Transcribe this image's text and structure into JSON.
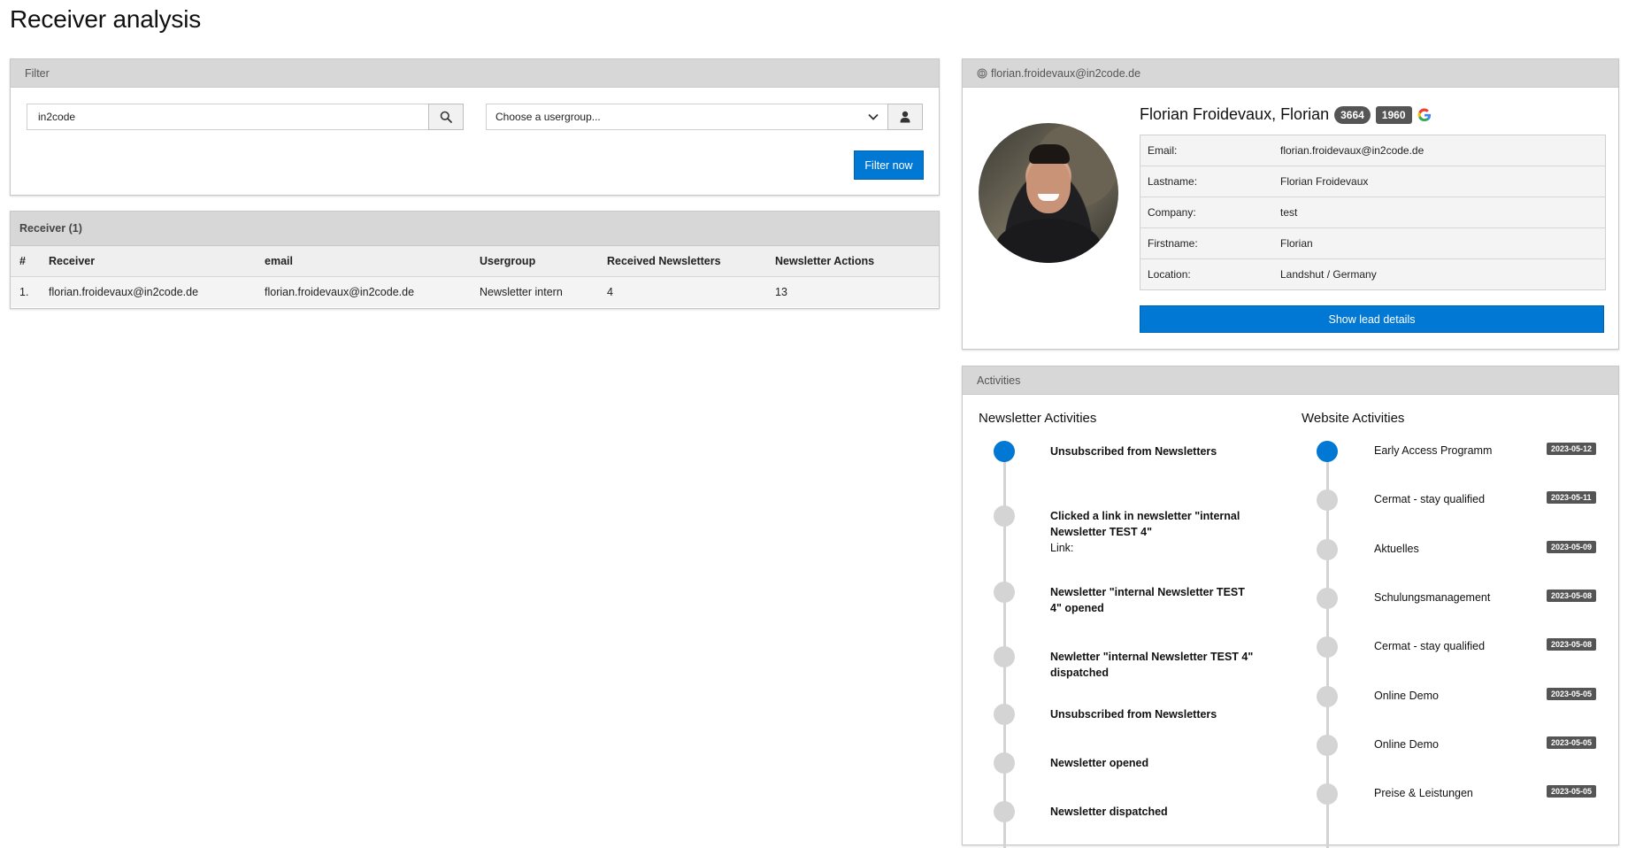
{
  "page": {
    "title": "Receiver analysis"
  },
  "filter": {
    "heading": "Filter",
    "search_value": "in2code",
    "usergroup_placeholder": "Choose a usergroup...",
    "submit_label": "Filter now"
  },
  "receiver": {
    "heading": "Receiver (1)",
    "columns": [
      "#",
      "Receiver",
      "email",
      "Usergroup",
      "Received Newsletters",
      "Newsletter Actions"
    ],
    "rows": [
      {
        "index": "1.",
        "receiver": "florian.froidevaux@in2code.de",
        "email": "florian.froidevaux@in2code.de",
        "usergroup": "Newsletter intern",
        "received": "4",
        "actions": "13"
      }
    ]
  },
  "lead": {
    "header_email": "florian.froidevaux@in2code.de",
    "name": "Florian Froidevaux, Florian",
    "badge_1": "3664",
    "badge_2": "1960",
    "details": [
      {
        "label": "Email:",
        "value": "florian.froidevaux@in2code.de"
      },
      {
        "label": "Lastname:",
        "value": "Florian Froidevaux"
      },
      {
        "label": "Company:",
        "value": "test"
      },
      {
        "label": "Firstname:",
        "value": "Florian"
      },
      {
        "label": "Location:",
        "value": "Landshut / Germany"
      }
    ],
    "details_button": "Show lead details"
  },
  "activities": {
    "heading": "Activities",
    "newsletter_title": "Newsletter Activities",
    "website_title": "Website Activities",
    "newsletter_items": [
      {
        "text": "Unsubscribed from Newsletters",
        "active": true
      },
      {
        "text": "Clicked a link in newsletter \"internal Newsletter TEST 4\"",
        "sub": "Link:",
        "active": false
      },
      {
        "text": "Newsletter \"internal Newsletter TEST 4\" opened",
        "active": false
      },
      {
        "text": "Newletter \"internal Newsletter TEST 4\" dispatched",
        "active": false
      },
      {
        "text": "Unsubscribed from Newsletters",
        "active": false
      },
      {
        "text": "Newsletter opened",
        "active": false
      },
      {
        "text": "Newsletter dispatched",
        "active": false
      }
    ],
    "website_items": [
      {
        "text": "Early Access Programm",
        "date": "2023-05-12",
        "active": true
      },
      {
        "text": "Cermat - stay qualified",
        "date": "2023-05-11",
        "active": false
      },
      {
        "text": "Aktuelles",
        "date": "2023-05-09",
        "active": false
      },
      {
        "text": "Schulungsmanagement",
        "date": "2023-05-08",
        "active": false
      },
      {
        "text": "Cermat - stay qualified",
        "date": "2023-05-08",
        "active": false
      },
      {
        "text": "Online Demo",
        "date": "2023-05-05",
        "active": false
      },
      {
        "text": "Online Demo",
        "date": "2023-05-05",
        "active": false
      },
      {
        "text": "Preise & Leistungen",
        "date": "2023-05-05",
        "active": false
      }
    ]
  }
}
